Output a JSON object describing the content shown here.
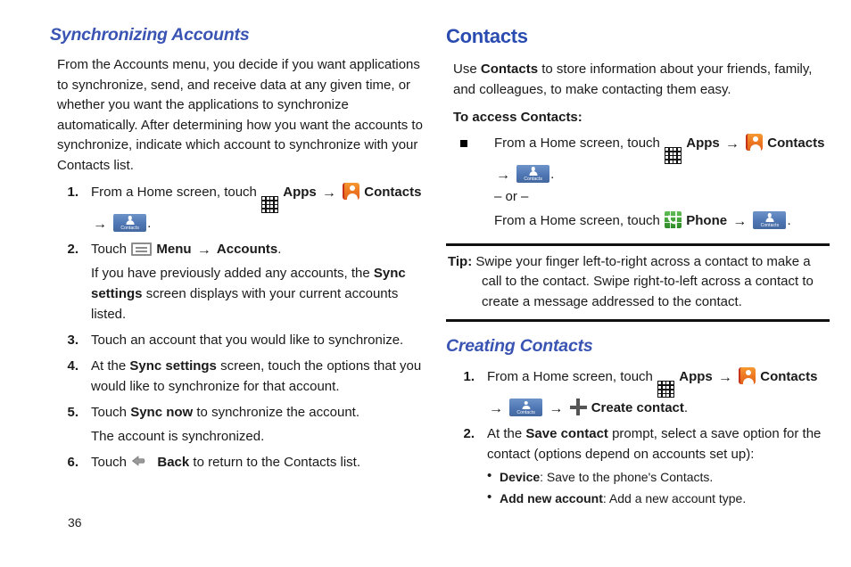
{
  "page": {
    "number": "36"
  },
  "left_column": {
    "heading": "Synchronizing Accounts",
    "intro": "From the Accounts menu, you decide if you want applications to synchronize, send, and receive data at any given time, or whether you want the applications to synchronize automatically. After determining how you want the accounts to synchronize, indicate which account to synchronize with your Contacts list.",
    "steps": [
      {
        "num": "1.",
        "pre": "From a Home screen, touch",
        "apps_label": "Apps",
        "contacts_label": "Contacts",
        "trailing": "."
      },
      {
        "num": "2.",
        "pre": "Touch",
        "menu_label": "Menu",
        "accounts_label": "Accounts",
        "trailing": ".",
        "cont_a": "If you have previously added any accounts, the",
        "cont_bold": "Sync settings",
        "cont_b": "screen displays with your current accounts listed."
      },
      {
        "num": "3.",
        "text": "Touch an account that you would like to synchronize."
      },
      {
        "num": "4.",
        "pre": "At the",
        "bold": "Sync settings",
        "post": "screen, touch the options that you would like to synchronize for that account."
      },
      {
        "num": "5.",
        "pre": "Touch",
        "bold": "Sync now",
        "post": "to synchronize the account.",
        "cont": "The account is synchronized."
      },
      {
        "num": "6.",
        "pre": "Touch",
        "back_label": "Back",
        "post": "to return to the Contacts list."
      }
    ]
  },
  "right_column": {
    "heading": "Contacts",
    "intro_a": "Use",
    "intro_bold": "Contacts",
    "intro_b": "to store information about your friends, family, and colleagues, to make contacting them easy.",
    "access_subhead": "To access Contacts:",
    "access_bullet": {
      "pre": "From a Home screen, touch",
      "apps_label": "Apps",
      "contacts_label": "Contacts",
      "trailing": ".",
      "or_text": "– or –",
      "alt_pre": "From a Home screen, touch",
      "phone_label": "Phone",
      "alt_trailing": "."
    },
    "tip": {
      "label": "Tip:",
      "text": "Swipe your finger left-to-right across a contact to make a call to the contact. Swipe right-to-left across a contact to create a message addressed to the contact."
    },
    "creating_heading": "Creating Contacts",
    "creating_steps": [
      {
        "num": "1.",
        "pre": "From a Home screen, touch",
        "apps_label": "Apps",
        "contacts_label": "Contacts",
        "create_label": "Create contact",
        "trailing": "."
      },
      {
        "num": "2.",
        "pre": "At the",
        "bold": "Save contact",
        "post": "prompt, select a save option for the contact (options depend on accounts set up):",
        "options": [
          {
            "term": "Device",
            "desc": ": Save to the phone's Contacts."
          },
          {
            "term": "Add new account",
            "desc": ": Add a new account type."
          }
        ]
      }
    ]
  },
  "icons": {
    "apps": "apps-grid-icon",
    "contacts_orange": "contacts-app-icon",
    "contacts_blue": "contacts-tab-icon",
    "phone": "phone-app-icon",
    "menu": "menu-icon",
    "back": "back-arrow-icon",
    "plus": "create-contact-plus-icon",
    "arrow": "→"
  },
  "colors": {
    "heading_blue": "#3a54b4",
    "contacts_orange": "#ee7a22",
    "contacts_blue": "#4f77b4",
    "phone_green": "#3f9f36"
  }
}
